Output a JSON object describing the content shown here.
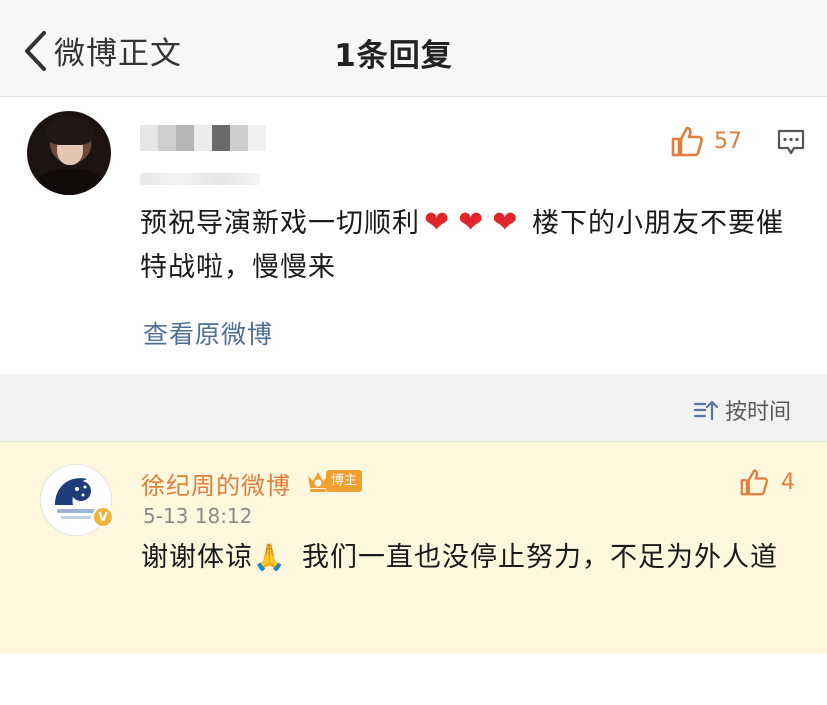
{
  "nav": {
    "back_label": "微博正文",
    "title": "1条回复"
  },
  "post": {
    "likes": "57",
    "text_part1": "预祝导演新戏一切顺利",
    "heart_glyph": "❤",
    "text_part2": "楼下的小朋友不要催特战啦，慢慢来",
    "view_original": "查看原微博"
  },
  "sort": {
    "label": "按时间"
  },
  "reply": {
    "username": "徐纪周的微博",
    "badge": "博主",
    "likes": "4",
    "time": "5-13 18:12",
    "text_part1": "谢谢体谅",
    "emoji": "🙏",
    "text_part2": "我们一直也没停止努力，不足为外人道"
  },
  "colors": {
    "accent_orange": "#e07e3c",
    "link_blue": "#4d6e96",
    "reply_bg": "#fff8de",
    "heart_red": "#e0262b"
  },
  "icons": {
    "back": "chevron-left-icon",
    "like": "thumbs-up-icon",
    "more": "comment-more-icon",
    "sort": "sort-time-icon",
    "crown": "crown-icon",
    "verified": "verified-v-icon"
  }
}
